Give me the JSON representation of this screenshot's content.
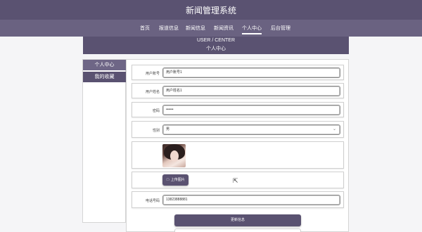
{
  "header": {
    "title": "新闻管理系统"
  },
  "nav": {
    "items": [
      {
        "label": "首页"
      },
      {
        "label": "报道信息"
      },
      {
        "label": "新闻信息"
      },
      {
        "label": "新闻资讯"
      },
      {
        "label": "个人中心",
        "active": true
      },
      {
        "label": "后台管理"
      }
    ]
  },
  "banner": {
    "en": "USER / CENTER",
    "cn": "个人中心"
  },
  "sidebar": {
    "items": [
      {
        "label": "个人中心"
      },
      {
        "label": "我的收藏"
      }
    ]
  },
  "form": {
    "account_label": "用户账号",
    "account_value": "用户账号1",
    "name_label": "用户姓名",
    "name_value": "用户姓名1",
    "password_label": "密码",
    "password_value": "••••••",
    "gender_label": "性别",
    "gender_value": "男",
    "upload_label": "上传图片",
    "phone_label": "电话号码",
    "phone_value": "13823888881",
    "submit_label": "更新信息"
  },
  "colors": {
    "primary": "#5a5271",
    "nav": "#6a6281"
  }
}
